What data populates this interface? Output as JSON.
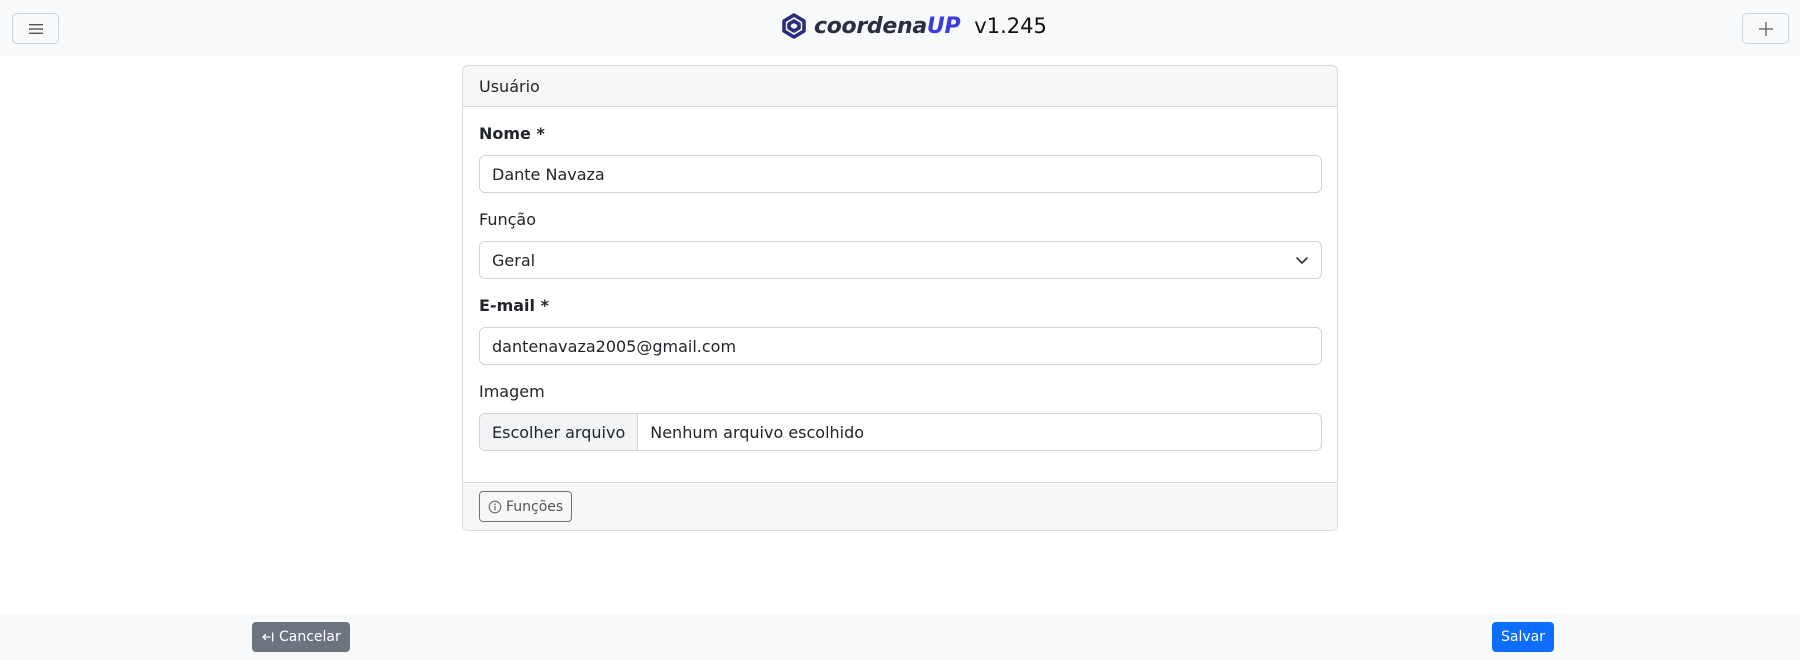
{
  "header": {
    "brand_main": "coordena",
    "brand_up": "UP",
    "version": "v1.245"
  },
  "card": {
    "title": "Usuário",
    "fields": {
      "nome_label": "Nome *",
      "nome_value": "Dante Navaza",
      "funcao_label": "Função",
      "funcao_value": "Geral",
      "email_label": "E-mail *",
      "email_value": "dantenavaza2005@gmail.com",
      "imagem_label": "Imagem",
      "file_button": "Escolher arquivo",
      "file_status": "Nenhum arquivo escolhido"
    },
    "footer": {
      "funcoes_label": "Funções"
    }
  },
  "actions": {
    "cancel_label": "Cancelar",
    "save_label": "Salvar"
  },
  "colors": {
    "primary": "#0d6efd",
    "secondary": "#6c757d",
    "brand_accent": "#3b3be0"
  },
  "icons": {
    "menu": "hamburger-icon",
    "add": "plus-icon",
    "info": "info-circle-icon",
    "back": "exit-arrow-icon",
    "dropdown": "chevron-down-icon"
  }
}
